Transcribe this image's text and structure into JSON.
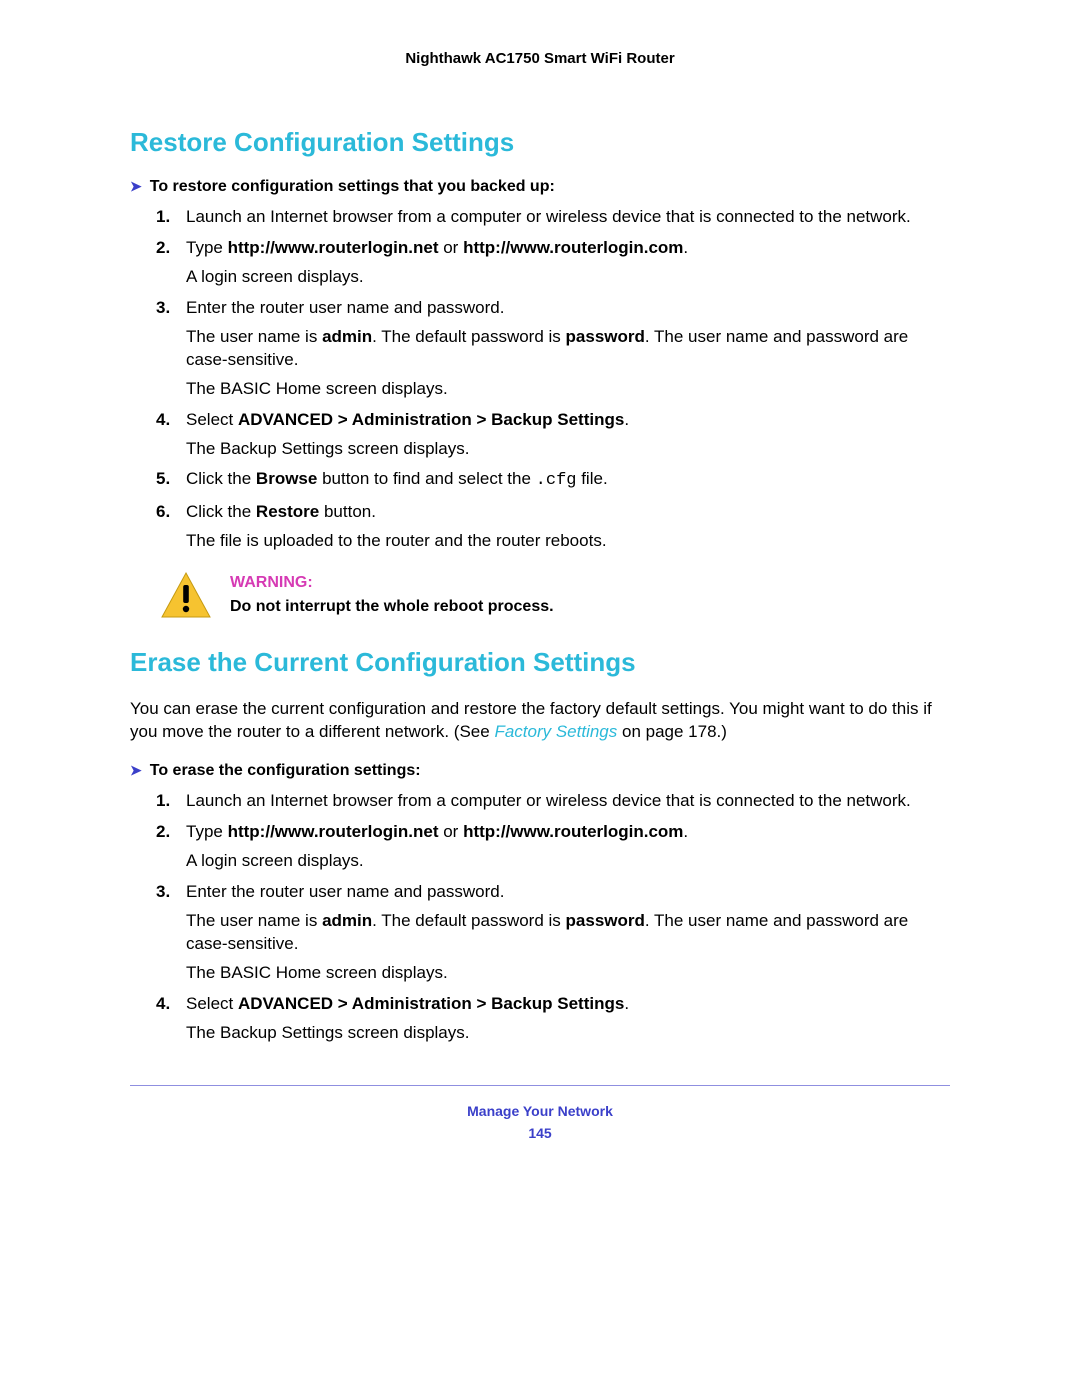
{
  "header": {
    "title": "Nighthawk AC1750 Smart WiFi Router"
  },
  "section1": {
    "heading": "Restore Configuration Settings",
    "lead_arrow": "To restore configuration settings that you backed up:",
    "steps": {
      "s1": {
        "num": "1.",
        "t": "Launch an Internet browser from a computer or wireless device that is connected to the network."
      },
      "s2": {
        "num": "2.",
        "pre": "Type ",
        "url1": "http://www.routerlogin.net",
        "mid": " or ",
        "url2": "http://www.routerlogin.com",
        "post": ".",
        "after": "A login screen displays."
      },
      "s3": {
        "num": "3.",
        "t": "Enter the router user name and password.",
        "p_a": "The user name is ",
        "admin": "admin",
        "p_b": ". The default password is ",
        "pwd": "password",
        "p_c": ". The user name and password are case-sensitive.",
        "after2": "The BASIC Home screen displays."
      },
      "s4": {
        "num": "4.",
        "pre": "Select ",
        "path": "ADVANCED > Administration > Backup Settings",
        "post": ".",
        "after": "The Backup Settings screen displays."
      },
      "s5": {
        "num": "5.",
        "pre": "Click the ",
        "btn": "Browse",
        "mid": " button to find and select the ",
        "file": ".cfg",
        "post": " file."
      },
      "s6": {
        "num": "6.",
        "pre": "Click the ",
        "btn": "Restore",
        "post": " button.",
        "after": "The file is uploaded to the router and the router reboots."
      }
    },
    "warning": {
      "label": "WARNING:",
      "body": "Do not interrupt the whole reboot process."
    }
  },
  "section2": {
    "heading": "Erase the Current Configuration Settings",
    "intro_a": "You can erase the current configuration and restore the factory default settings. You might want to do this if you move the router to a different network. (See ",
    "intro_link": "Factory Settings",
    "intro_b": " on page 178.)",
    "lead_arrow": "To erase the configuration settings:",
    "steps": {
      "s1": {
        "num": "1.",
        "t": "Launch an Internet browser from a computer or wireless device that is connected to the network."
      },
      "s2": {
        "num": "2.",
        "pre": "Type ",
        "url1": "http://www.routerlogin.net",
        "mid": " or ",
        "url2": "http://www.routerlogin.com",
        "post": ".",
        "after": "A login screen displays."
      },
      "s3": {
        "num": "3.",
        "t": "Enter the router user name and password.",
        "p_a": "The user name is ",
        "admin": "admin",
        "p_b": ". The default password is ",
        "pwd": "password",
        "p_c": ". The user name and password are case-sensitive.",
        "after2": "The BASIC Home screen displays."
      },
      "s4": {
        "num": "4.",
        "pre": "Select ",
        "path": "ADVANCED > Administration > Backup Settings",
        "post": ".",
        "after": "The Backup Settings screen displays."
      }
    }
  },
  "footer": {
    "chapter": "Manage Your Network",
    "page": "145"
  }
}
